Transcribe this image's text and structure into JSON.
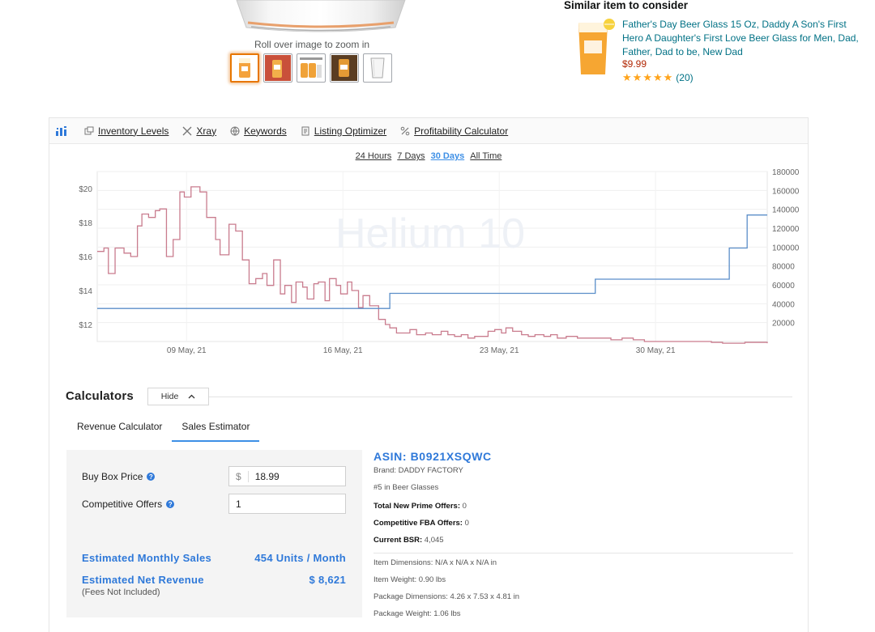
{
  "product": {
    "zoom_hint": "Roll over image to zoom in"
  },
  "similar": {
    "title": "Similar item to consider",
    "name": "Father's Day Beer Glass 15 Oz, Daddy A Son's First Hero A Daughter's First Love Beer Glass for Men, Dad, Father, Dad to be, New Dad",
    "price": "$9.99",
    "rating": 5,
    "reviews": "(20)"
  },
  "toolbar": {
    "items": [
      "Inventory Levels",
      "Xray",
      "Keywords",
      "Listing Optimizer",
      "Profitability Calculator"
    ]
  },
  "ranges": {
    "options": [
      "24 Hours",
      "7 Days",
      "30 Days",
      "All Time"
    ],
    "selected": "30 Days"
  },
  "chart_data": {
    "type": "line",
    "watermark": "Helium 10",
    "x_ticks": [
      "09 May, 21",
      "16 May, 21",
      "23 May, 21",
      "30 May, 21"
    ],
    "x_range_days": [
      0,
      30
    ],
    "x_tick_days": [
      4,
      11,
      18,
      25
    ],
    "y_left_ticks": [
      "$12",
      "$14",
      "$16",
      "$18",
      "$20"
    ],
    "y_left_range": [
      11.0,
      21.0
    ],
    "y_right_ticks": [
      "20000",
      "40000",
      "60000",
      "80000",
      "100000",
      "120000",
      "140000",
      "160000",
      "180000"
    ],
    "y_right_range": [
      0,
      180000
    ],
    "series": [
      {
        "name": "Price",
        "axis": "left",
        "color": "#c97c8e",
        "step": true,
        "points": [
          [
            0,
            16.3
          ],
          [
            0.3,
            16.5
          ],
          [
            0.5,
            15.0
          ],
          [
            0.8,
            16.5
          ],
          [
            1.2,
            16.2
          ],
          [
            1.5,
            16.0
          ],
          [
            1.8,
            17.8
          ],
          [
            2.0,
            18.5
          ],
          [
            2.3,
            18.3
          ],
          [
            2.6,
            18.7
          ],
          [
            2.8,
            18.8
          ],
          [
            3.1,
            16.0
          ],
          [
            3.4,
            17.0
          ],
          [
            3.7,
            19.8
          ],
          [
            3.9,
            19.5
          ],
          [
            4.2,
            20.1
          ],
          [
            4.6,
            19.8
          ],
          [
            4.9,
            18.3
          ],
          [
            5.3,
            17.0
          ],
          [
            5.5,
            16.1
          ],
          [
            5.9,
            17.9
          ],
          [
            6.2,
            17.5
          ],
          [
            6.5,
            15.8
          ],
          [
            6.8,
            14.4
          ],
          [
            7.1,
            14.7
          ],
          [
            7.4,
            15.0
          ],
          [
            7.6,
            14.3
          ],
          [
            7.9,
            15.8
          ],
          [
            8.2,
            13.8
          ],
          [
            8.4,
            14.3
          ],
          [
            8.7,
            13.3
          ],
          [
            8.9,
            14.5
          ],
          [
            9.2,
            14.2
          ],
          [
            9.4,
            13.5
          ],
          [
            9.7,
            14.4
          ],
          [
            9.9,
            14.5
          ],
          [
            10.2,
            13.4
          ],
          [
            10.4,
            14.7
          ],
          [
            10.7,
            14.3
          ],
          [
            10.9,
            13.8
          ],
          [
            11.2,
            14.5
          ],
          [
            11.4,
            14.0
          ],
          [
            11.7,
            13.0
          ],
          [
            11.9,
            13.7
          ],
          [
            12.2,
            13.1
          ],
          [
            12.6,
            12.3
          ],
          [
            12.9,
            12.0
          ],
          [
            13.1,
            11.8
          ],
          [
            13.4,
            11.5
          ],
          [
            13.7,
            11.5
          ],
          [
            14.0,
            11.7
          ],
          [
            14.3,
            11.4
          ],
          [
            14.7,
            11.5
          ],
          [
            15.0,
            11.4
          ],
          [
            15.4,
            11.6
          ],
          [
            15.7,
            11.4
          ],
          [
            16.0,
            11.3
          ],
          [
            16.3,
            11.4
          ],
          [
            16.6,
            11.2
          ],
          [
            16.9,
            11.3
          ],
          [
            17.2,
            11.3
          ],
          [
            17.5,
            11.6
          ],
          [
            17.8,
            11.7
          ],
          [
            18.1,
            11.5
          ],
          [
            18.3,
            11.8
          ],
          [
            18.6,
            11.6
          ],
          [
            19.0,
            11.4
          ],
          [
            19.3,
            11.3
          ],
          [
            19.6,
            11.4
          ],
          [
            20.0,
            11.3
          ],
          [
            20.3,
            11.4
          ],
          [
            20.6,
            11.2
          ],
          [
            21.0,
            11.3
          ],
          [
            21.5,
            11.2
          ],
          [
            22.0,
            11.2
          ],
          [
            22.5,
            11.2
          ],
          [
            23.0,
            11.1
          ],
          [
            23.5,
            11.2
          ],
          [
            24.0,
            11.1
          ],
          [
            24.5,
            11.0
          ],
          [
            25.0,
            11.0
          ],
          [
            25.5,
            11.0
          ],
          [
            26.0,
            11.0
          ],
          [
            26.5,
            11.0
          ],
          [
            27.0,
            11.0
          ],
          [
            27.5,
            10.95
          ],
          [
            28.0,
            10.9
          ],
          [
            28.5,
            10.9
          ],
          [
            29.0,
            10.95
          ],
          [
            30.0,
            10.9
          ]
        ]
      },
      {
        "name": "BSR",
        "axis": "right",
        "color": "#5b8ec9",
        "step": true,
        "points": [
          [
            0,
            35000
          ],
          [
            13.0,
            35000
          ],
          [
            13.1,
            51000
          ],
          [
            22.2,
            51000
          ],
          [
            22.3,
            66000
          ],
          [
            28.2,
            66000
          ],
          [
            28.3,
            99000
          ],
          [
            29.0,
            99000
          ],
          [
            29.1,
            134000
          ],
          [
            30,
            134000
          ]
        ]
      }
    ]
  },
  "calculators": {
    "title": "Calculators",
    "hide_label": "Hide",
    "tabs": [
      "Revenue Calculator",
      "Sales Estimator"
    ],
    "active_tab": "Sales Estimator",
    "buy_box_label": "Buy Box Price",
    "currency": "$",
    "buy_box_value": "18.99",
    "offers_label": "Competitive Offers",
    "offers_value": "1",
    "est_sales_label": "Estimated Monthly Sales",
    "est_sales_value": "454 Units / Month",
    "est_revenue_label": "Estimated Net Revenue",
    "est_revenue_value": "$ 8,621",
    "fees_note": "(Fees Not Included)"
  },
  "info": {
    "asin": "ASIN: B0921XSQWC",
    "brand": "Brand: DADDY FACTORY",
    "rank": "#5 in Beer Glasses",
    "prime_label": "Total New Prime Offers:",
    "prime_value": " 0",
    "fba_label": "Competitive FBA Offers:",
    "fba_value": " 0",
    "bsr_label": "Current BSR:",
    "bsr_value": " 4,045",
    "item_dims": "Item Dimensions: N/A x N/A x N/A in",
    "item_weight": "Item Weight: 0.90 lbs",
    "pkg_dims": "Package Dimensions: 4.26 x 7.53 x 4.81 in",
    "pkg_weight": "Package Weight: 1.06 lbs"
  }
}
